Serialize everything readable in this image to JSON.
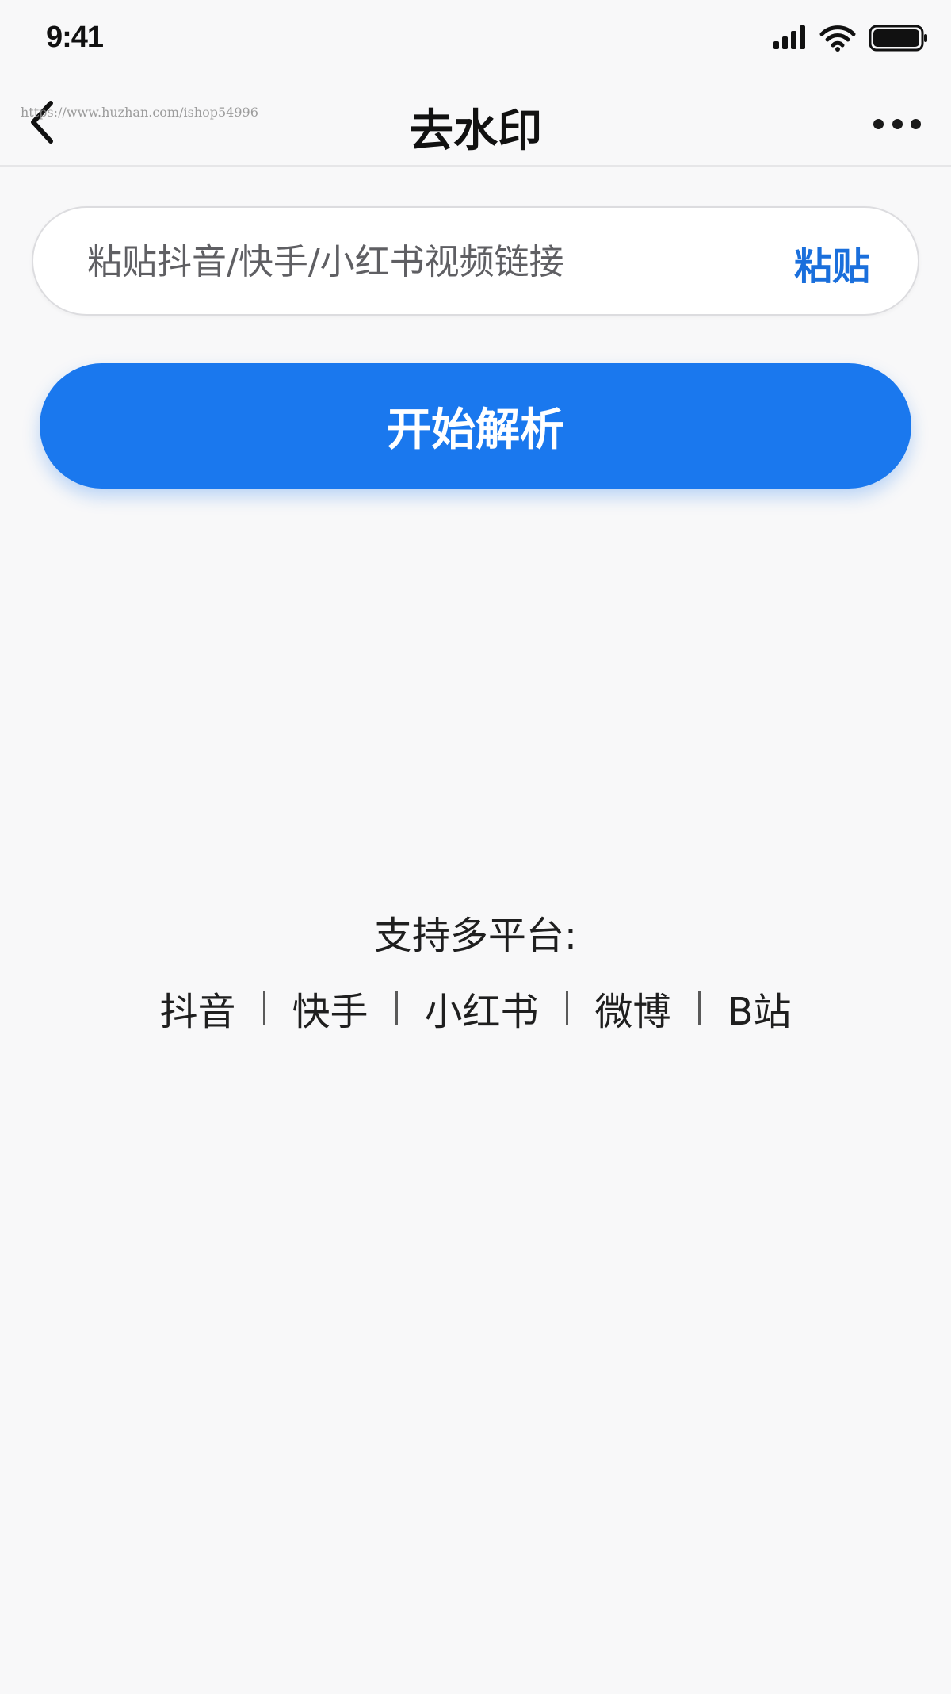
{
  "status_bar": {
    "time": "9:41"
  },
  "nav": {
    "title": "去水印",
    "watermark": "https://www.huzhan.com/ishop54996",
    "back_icon": "chevron-left-icon",
    "more_icon": "more-horizontal-icon"
  },
  "link_input": {
    "placeholder": "粘贴抖音/快手/小红书视频链接",
    "value": "",
    "paste_label": "粘贴"
  },
  "parse_button": {
    "label": "开始解析"
  },
  "support": {
    "title": "支持多平台:",
    "platforms": [
      "抖音",
      "快手",
      "小红书",
      "微博",
      "B站"
    ]
  },
  "colors": {
    "accent": "#1a78ee",
    "link": "#1a6fdc",
    "background": "#f8f8f9"
  }
}
